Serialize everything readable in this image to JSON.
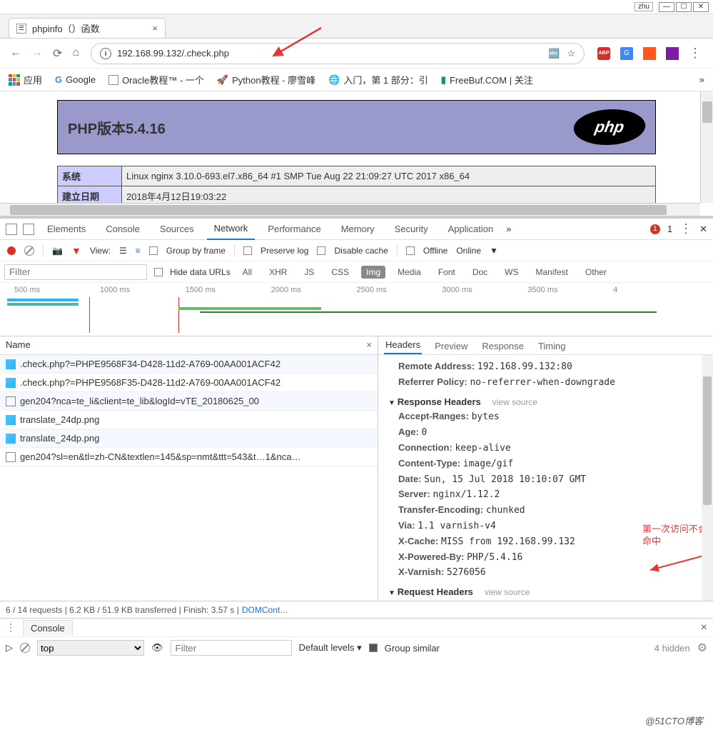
{
  "window": {
    "user": "zhu"
  },
  "browser": {
    "tab_title": "phpinfo（）函数",
    "url": "192.168.99.132/.check.php",
    "bookmarks": [
      {
        "icon": "apps",
        "label": "应用"
      },
      {
        "icon": "g",
        "label": "Google"
      },
      {
        "icon": "doc",
        "label": "Oracle教程™ - 一个"
      },
      {
        "icon": "rocket",
        "label": "Python教程 - 廖雪峰"
      },
      {
        "icon": "globe",
        "label": "入门，第 1 部分：引"
      },
      {
        "icon": "fb",
        "label": "FreeBuf.COM | 关注"
      }
    ]
  },
  "page_content": {
    "php_title": "PHP版本5.4.16",
    "rows": [
      {
        "h": "系统",
        "v": "Linux nginx 3.10.0-693.el7.x86_64 #1 SMP Tue Aug 22 21:09:27 UTC 2017 x86_64"
      },
      {
        "h": "建立日期",
        "v": "2018年4月12日19:03:22"
      }
    ]
  },
  "devtools": {
    "tabs": [
      "Elements",
      "Console",
      "Sources",
      "Network",
      "Performance",
      "Memory",
      "Security",
      "Application"
    ],
    "active_tab": "Network",
    "error_count": "1",
    "toolbar": {
      "view_label": "View:",
      "group_by_frame": "Group by frame",
      "preserve_log": "Preserve log",
      "disable_cache": "Disable cache",
      "offline": "Offline",
      "online": "Online"
    },
    "filter": {
      "placeholder": "Filter",
      "hide_data": "Hide data URLs",
      "types": [
        "All",
        "XHR",
        "JS",
        "CSS",
        "Img",
        "Media",
        "Font",
        "Doc",
        "WS",
        "Manifest",
        "Other"
      ],
      "active_type": "Img"
    },
    "timeline_ticks": [
      "500 ms",
      "1000 ms",
      "1500 ms",
      "2000 ms",
      "2500 ms",
      "3000 ms",
      "3500 ms",
      "4"
    ],
    "requests_header": "Name",
    "requests": [
      ".check.php?=PHPE9568F34-D428-11d2-A769-00AA001ACF42",
      ".check.php?=PHPE9568F35-D428-11d2-A769-00AA001ACF42",
      "gen204?nca=te_li&client=te_lib&logId=vTE_20180625_00",
      "translate_24dp.png",
      "translate_24dp.png",
      "gen204?sl=en&tl=zh-CN&textlen=145&sp=nmt&ttt=543&t…1&nca…"
    ],
    "detail_tabs": [
      "Headers",
      "Preview",
      "Response",
      "Timing"
    ],
    "detail_active": "Headers",
    "general": {
      "remote_addr_k": "Remote Address:",
      "remote_addr_v": "192.168.99.132:80",
      "referrer_k": "Referrer Policy:",
      "referrer_v": "no-referrer-when-downgrade"
    },
    "resp_title": "Response Headers",
    "view_source": "view source",
    "resp": [
      {
        "k": "Accept-Ranges:",
        "v": "bytes"
      },
      {
        "k": "Age:",
        "v": "0"
      },
      {
        "k": "Connection:",
        "v": "keep-alive"
      },
      {
        "k": "Content-Type:",
        "v": "image/gif"
      },
      {
        "k": "Date:",
        "v": "Sun, 15 Jul 2018 10:10:07 GMT"
      },
      {
        "k": "Server:",
        "v": "nginx/1.12.2"
      },
      {
        "k": "Transfer-Encoding:",
        "v": "chunked"
      },
      {
        "k": "Via:",
        "v": "1.1 varnish-v4"
      },
      {
        "k": "X-Cache:",
        "v": "MISS from 192.168.99.132"
      },
      {
        "k": "X-Powered-By:",
        "v": "PHP/5.4.16"
      },
      {
        "k": "X-Varnish:",
        "v": "5276056"
      }
    ],
    "req_title": "Request Headers",
    "status": "6 / 14 requests  |  6.2 KB / 51.9 KB transferred  |  Finish: 3.57 s  |  ",
    "status_link": "DOMCont…"
  },
  "console_drawer": {
    "label": "Console",
    "context": "top",
    "filter_ph": "Filter",
    "levels": "Default levels ▾",
    "group_similar": "Group similar",
    "hidden": "4 hidden"
  },
  "annotation": {
    "text1": "第一次访问不会",
    "text2": "命中"
  },
  "watermark": "@51CTO博客"
}
